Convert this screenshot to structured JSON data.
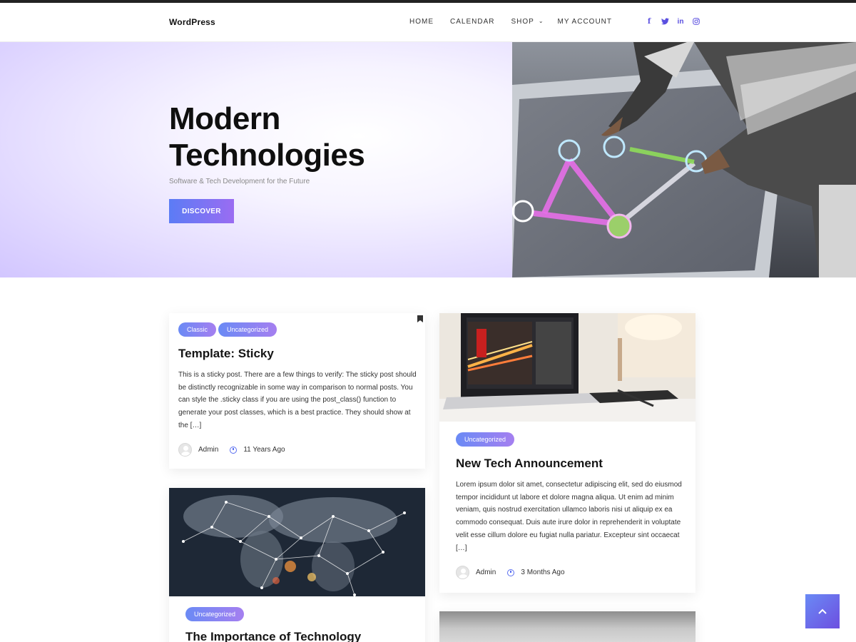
{
  "site": {
    "logo": "WordPress"
  },
  "nav": {
    "home": "HOME",
    "calendar": "CALENDAR",
    "shop": "SHOP",
    "my_account": "MY ACCOUNT"
  },
  "social": {
    "facebook": "f",
    "twitter": "twitter-icon",
    "linkedin": "in",
    "instagram": "instagram-icon"
  },
  "hero": {
    "title_line1": "Modern",
    "title_line2": "Technologies",
    "subtitle": "Software & Tech Development for the Future",
    "button": "DISCOVER"
  },
  "posts": [
    {
      "tags": [
        "Classic",
        "Uncategorized"
      ],
      "title": "Template: Sticky",
      "excerpt": "This is a sticky post. There are a few things to verify: The sticky post should be distinctly recognizable in some way in comparison to normal posts. You can style the .sticky class if you are using the post_class() function to generate your post classes, which is a best practice. They should show at the […]",
      "author": "Admin",
      "date": "11 Years Ago"
    },
    {
      "tags": [
        "Uncategorized"
      ],
      "title": "New Tech Announcement",
      "excerpt": "Lorem ipsum dolor sit amet, consectetur adipiscing elit, sed do eiusmod tempor incididunt ut labore et dolore magna aliqua. Ut enim ad minim veniam, quis nostrud exercitation ullamco laboris nisi ut aliquip ex ea commodo consequat. Duis aute irure dolor in reprehenderit in voluptate velit esse cillum dolore eu fugiat nulla pariatur. Excepteur sint occaecat […]",
      "author": "Admin",
      "date": "3 Months Ago"
    },
    {
      "tags": [
        "Uncategorized"
      ],
      "title": "The Importance of Technology"
    }
  ],
  "colors": {
    "accent_start": "#5b7cf5",
    "accent_end": "#9a6cf2",
    "hero_bg": "#e3dbff"
  }
}
